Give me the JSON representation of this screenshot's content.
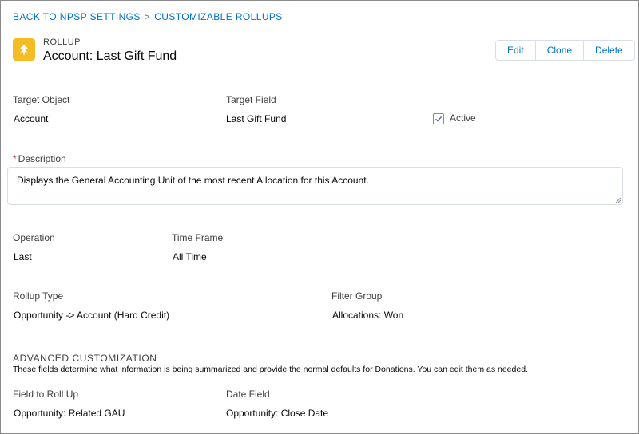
{
  "breadcrumb": {
    "back_link": "BACK TO NPSP SETTINGS",
    "separator": ">",
    "current_link": "CUSTOMIZABLE ROLLUPS"
  },
  "header": {
    "icon": "rollup-icon",
    "icon_color": "#f4bc25",
    "eyebrow": "ROLLUP",
    "title": "Account: Last Gift Fund"
  },
  "actions": {
    "edit": "Edit",
    "clone": "Clone",
    "delete": "Delete"
  },
  "fields": {
    "target_object": {
      "label": "Target Object",
      "value": "Account"
    },
    "target_field": {
      "label": "Target Field",
      "value": "Last Gift Fund"
    },
    "active": {
      "label": "Active",
      "checked": true
    },
    "description": {
      "required_marker": "*",
      "label": "Description",
      "value": "Displays the General Accounting Unit of the most recent Allocation for this Account."
    },
    "operation": {
      "label": "Operation",
      "value": "Last"
    },
    "time_frame": {
      "label": "Time Frame",
      "value": "All Time"
    },
    "rollup_type": {
      "label": "Rollup Type",
      "value": "Opportunity -> Account (Hard Credit)"
    },
    "filter_group": {
      "label": "Filter Group",
      "value": "Allocations: Won"
    }
  },
  "advanced": {
    "title": "ADVANCED CUSTOMIZATION",
    "description": "These fields determine what information is being summarized and provide the normal defaults for Donations. You can edit them as needed.",
    "field_to_roll_up": {
      "label": "Field to Roll Up",
      "value": "Opportunity: Related GAU"
    },
    "date_field": {
      "label": "Date Field",
      "value": "Opportunity: Close Date"
    }
  },
  "colors": {
    "link": "#0070d2",
    "accent_icon": "#f4bc25",
    "required": "#c23934"
  }
}
